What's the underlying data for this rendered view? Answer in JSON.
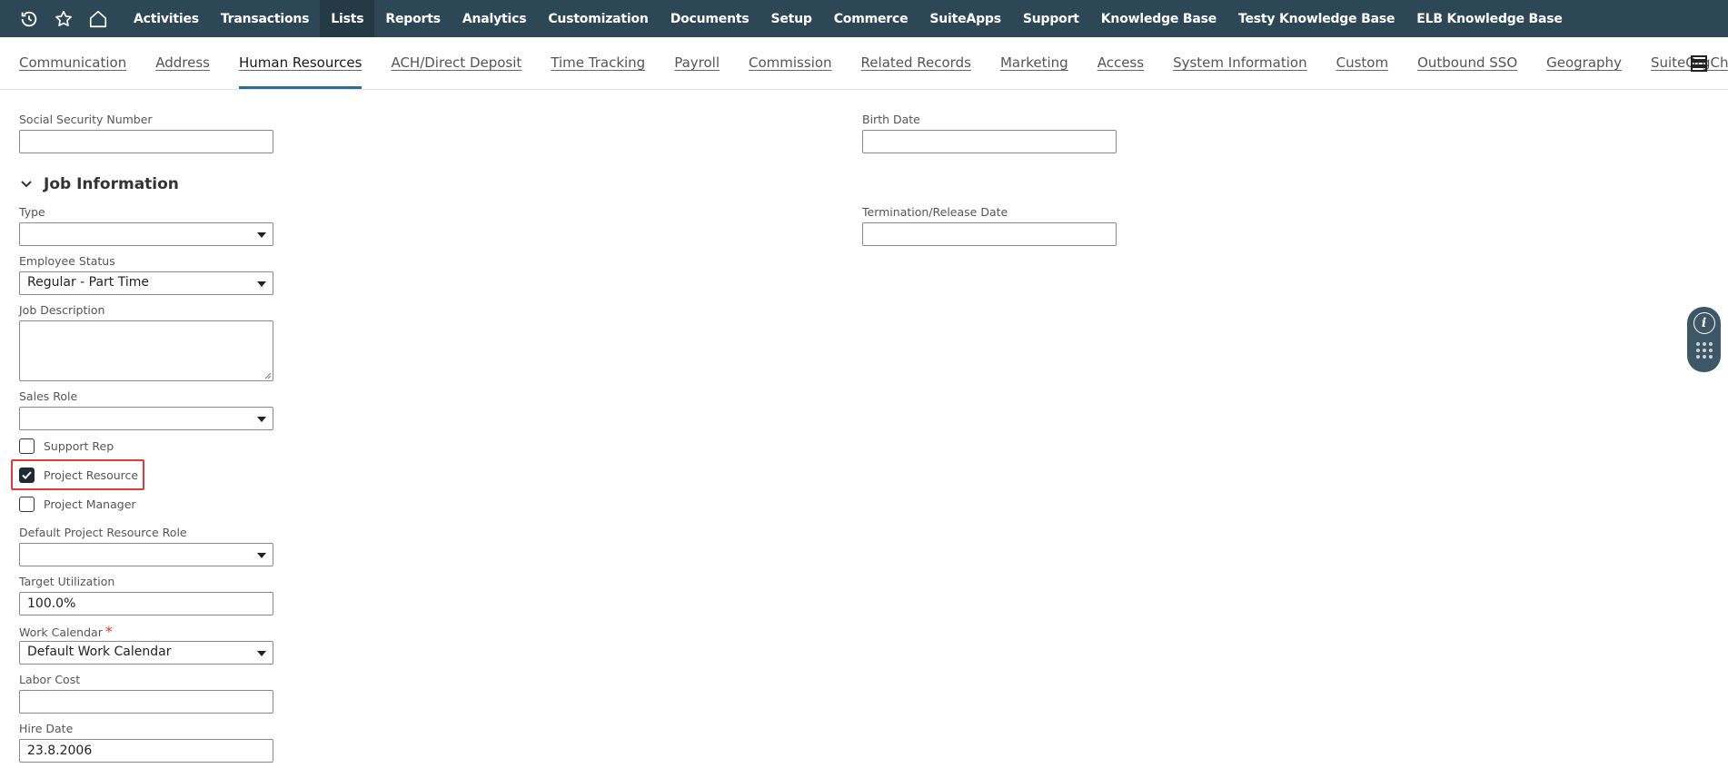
{
  "topnav": {
    "icons": [
      "history-icon",
      "star-icon",
      "home-icon"
    ],
    "items": [
      {
        "label": "Activities"
      },
      {
        "label": "Transactions"
      },
      {
        "label": "Lists",
        "active": true
      },
      {
        "label": "Reports"
      },
      {
        "label": "Analytics"
      },
      {
        "label": "Customization"
      },
      {
        "label": "Documents"
      },
      {
        "label": "Setup"
      },
      {
        "label": "Commerce"
      },
      {
        "label": "SuiteApps"
      },
      {
        "label": "Support"
      },
      {
        "label": "Knowledge Base"
      },
      {
        "label": "Testy Knowledge Base"
      },
      {
        "label": "ELB Knowledge Base"
      }
    ],
    "bg_color": "#2e4756"
  },
  "subtabs": [
    {
      "label": "Communication"
    },
    {
      "label": "Address"
    },
    {
      "label": "Human Resources",
      "active": true
    },
    {
      "label": "ACH/Direct Deposit"
    },
    {
      "label": "Time Tracking"
    },
    {
      "label": "Payroll"
    },
    {
      "label": "Commission"
    },
    {
      "label": "Related Records"
    },
    {
      "label": "Marketing"
    },
    {
      "label": "Access"
    },
    {
      "label": "System Information"
    },
    {
      "label": "Custom"
    },
    {
      "label": "Outbound SSO"
    },
    {
      "label": "Geography"
    },
    {
      "label": "SuiteOrgChart BETA"
    }
  ],
  "form": {
    "ssn": {
      "label": "Social Security Number",
      "value": ""
    },
    "birth_date": {
      "label": "Birth Date",
      "value": ""
    },
    "section_title": "Job Information",
    "type": {
      "label": "Type",
      "value": ""
    },
    "termination_date": {
      "label": "Termination/Release Date",
      "value": ""
    },
    "employee_status": {
      "label": "Employee Status",
      "value": "Regular - Part Time"
    },
    "job_description": {
      "label": "Job Description",
      "value": ""
    },
    "sales_role": {
      "label": "Sales Role",
      "value": ""
    },
    "support_rep": {
      "label": "Support Rep",
      "checked": false
    },
    "project_resource": {
      "label": "Project Resource",
      "checked": true
    },
    "project_manager": {
      "label": "Project Manager",
      "checked": false
    },
    "default_project_resource_role": {
      "label": "Default Project Resource Role",
      "value": ""
    },
    "target_utilization": {
      "label": "Target Utilization",
      "value": "100.0%"
    },
    "work_calendar": {
      "label": "Work Calendar",
      "required_mark": "*",
      "value": "Default Work Calendar"
    },
    "labor_cost": {
      "label": "Labor Cost",
      "value": ""
    },
    "hire_date": {
      "label": "Hire Date",
      "value": "23.8.2006"
    }
  },
  "colors": {
    "accent": "#2d6d8f",
    "highlight": "#e0393e",
    "required": "#d93a2b"
  }
}
